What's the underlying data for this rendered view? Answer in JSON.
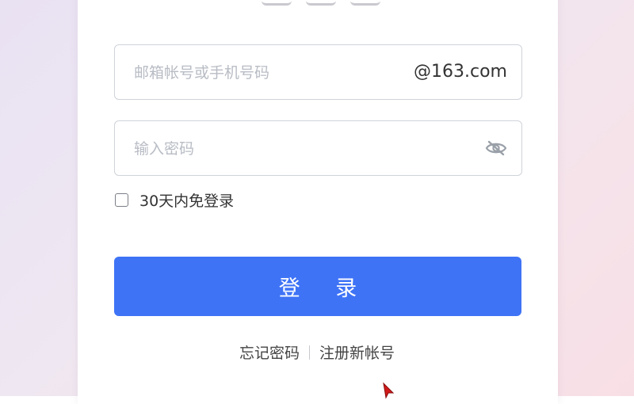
{
  "login": {
    "email_field": {
      "value": "",
      "placeholder": "邮箱帐号或手机号码",
      "domain_suffix": "@163.com"
    },
    "password_field": {
      "value": "",
      "placeholder": "输入密码",
      "toggle_icon": "eye-slash-icon"
    },
    "remember": {
      "label": "30天内免登录",
      "checked": false
    },
    "submit_label": "登 录",
    "links": {
      "forgot_password": "忘记密码",
      "register": "注册新帐号"
    }
  },
  "colors": {
    "primary": "#3e73f6",
    "border": "#cfd3d9",
    "placeholder": "#b8bcc4",
    "text": "#333333"
  }
}
